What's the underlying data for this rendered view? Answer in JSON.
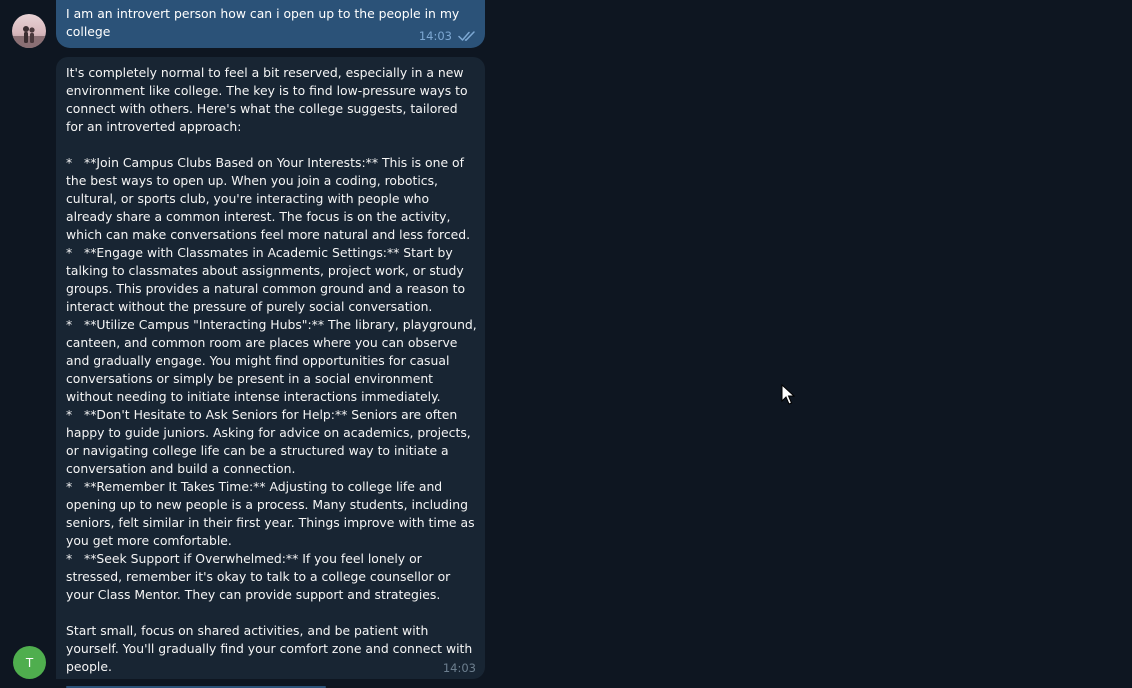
{
  "user_message": {
    "text": "I am an introvert person how can i open up to the people in my college",
    "time": "14:03",
    "status_icon": "double-check-icon"
  },
  "bot_message": {
    "text": "It's completely normal to feel a bit reserved, especially in a new environment like college. The key is to find low-pressure ways to connect with others. Here's what the college suggests, tailored for an introverted approach:\n\n*   **Join Campus Clubs Based on Your Interests:** This is one of the best ways to open up. When you join a coding, robotics, cultural, or sports club, you're interacting with people who already share a common interest. The focus is on the activity, which can make conversations feel more natural and less forced.\n*   **Engage with Classmates in Academic Settings:** Start by talking to classmates about assignments, project work, or study groups. This provides a natural common ground and a reason to interact without the pressure of purely social conversation.\n*   **Utilize Campus \"Interacting Hubs\":** The library, playground, canteen, and common room are places where you can observe and gradually engage. You might find opportunities for casual conversations or simply be present in a social environment without needing to initiate intense interactions immediately.\n*   **Don't Hesitate to Ask Seniors for Help:** Seniors are often happy to guide juniors. Asking for advice on academics, projects, or navigating college life can be a structured way to initiate a conversation and build a connection.\n*   **Remember It Takes Time:** Adjusting to college life and opening up to new people is a process. Many students, including seniors, felt similar in their first year. Things improve with time as you get more comfortable.\n*   **Seek Support if Overwhelmed:** If you feel lonely or stressed, remember it's okay to talk to a college counsellor or your Class Mentor. They can provide support and strategies.\n\nStart small, focus on shared activities, and be patient with yourself. You'll gradually find your comfort zone and connect with people.",
    "time": "14:03"
  },
  "bot_avatar": {
    "initial": "T",
    "color": "#4fae4e"
  },
  "colors": {
    "background": "#0e1621",
    "outgoing_bubble": "#2b5278",
    "incoming_bubble": "#182533"
  }
}
